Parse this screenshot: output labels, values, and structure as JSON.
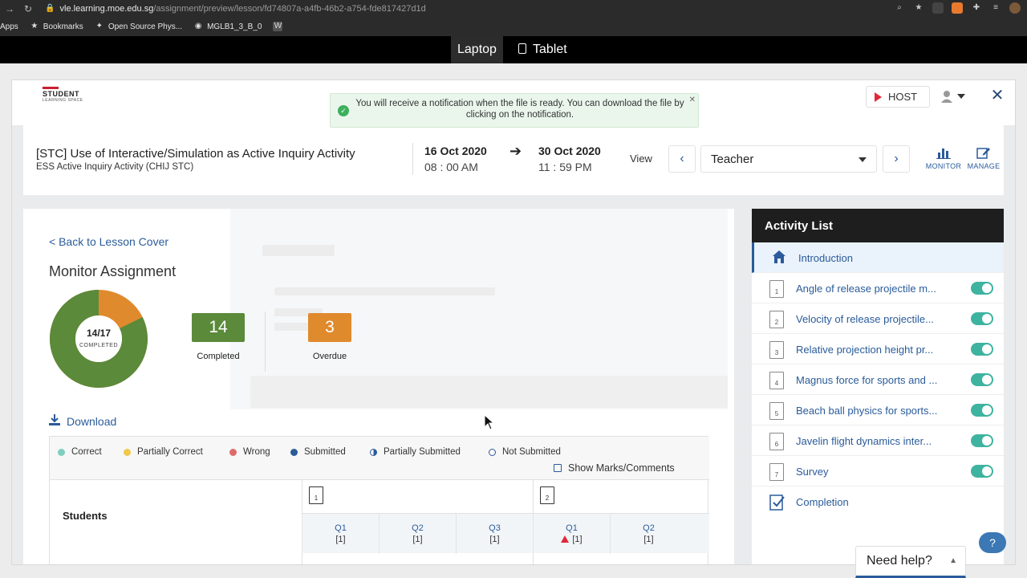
{
  "browser": {
    "url_host": "vle.learning.moe.edu.sg",
    "url_path": "/assignment/preview/lesson/fd74807a-a4fb-46b2-a754-fde817427d1d",
    "bookmarks": [
      "Apps",
      "Bookmarks",
      "Open Source Phys...",
      "MGLB1_3_B_0"
    ]
  },
  "device_toggle": {
    "laptop": "Laptop",
    "tablet": "Tablet",
    "active": "Laptop"
  },
  "header": {
    "logo_line1": "STUDENT",
    "logo_line2": "LEARNING SPACE",
    "host_label": "HOST",
    "toast": "You will receive a notification when the file is ready. You can download the file by clicking on the notification."
  },
  "lesson": {
    "title": "[STC] Use of Interactive/Simulation as Active Inquiry Activity",
    "subtitle": "ESS Active Inquiry Activity (CHIJ STC)",
    "start_date": "16 Oct 2020",
    "start_time": "08 : 00 AM",
    "end_date": "30 Oct 2020",
    "end_time": "11 : 59 PM",
    "view_label": "View",
    "view_value": "Teacher",
    "monitor_label": "MONITOR",
    "manage_label": "MANAGE"
  },
  "monitor": {
    "back_link": "< Back to Lesson Cover",
    "title": "Monitor Assignment",
    "donut_value": "14/17",
    "donut_caption": "COMPLETED",
    "completed_fraction": 0.8235,
    "completed_count": "14",
    "completed_label": "Completed",
    "overdue_count": "3",
    "overdue_label": "Overdue",
    "colors": {
      "completed": "#5a8a3a",
      "overdue": "#e08a2e"
    },
    "download_label": "Download"
  },
  "legend": [
    {
      "label": "Correct",
      "color": "#7fcfc0",
      "style": "solid"
    },
    {
      "label": "Partially Correct",
      "color": "#f0c84a",
      "style": "solid"
    },
    {
      "label": "Wrong",
      "color": "#e06a6a",
      "style": "solid"
    },
    {
      "label": "Submitted",
      "color": "#2a5b9a",
      "style": "solid"
    },
    {
      "label": "Partially Submitted",
      "color": "#2a5b9a",
      "style": "half"
    },
    {
      "label": "Not Submitted",
      "color": "#2a5b9a",
      "style": "ring"
    }
  ],
  "table": {
    "show_marks": "Show Marks/Comments",
    "students_header": "Students",
    "activity_groups": [
      {
        "number": "1"
      },
      {
        "number": "2"
      }
    ],
    "questions": [
      {
        "q": "Q1",
        "marks": "[1]",
        "warning": false
      },
      {
        "q": "Q2",
        "marks": "[1]",
        "warning": false
      },
      {
        "q": "Q3",
        "marks": "[1]",
        "warning": false
      },
      {
        "q": "Q1",
        "marks": "[1]",
        "warning": true
      },
      {
        "q": "Q2",
        "marks": "[1]",
        "warning": false
      }
    ]
  },
  "activity_list": {
    "title": "Activity List",
    "items": [
      {
        "label": "Introduction",
        "icon": "home-icon",
        "selected": true,
        "toggle": false
      },
      {
        "label": "Angle of release projectile m...",
        "number": "1",
        "toggle": true
      },
      {
        "label": "Velocity of release projectile...",
        "number": "2",
        "toggle": true
      },
      {
        "label": "Relative projection height pr...",
        "number": "3",
        "toggle": true
      },
      {
        "label": "Magnus force for sports and ...",
        "number": "4",
        "toggle": true
      },
      {
        "label": "Beach ball physics for sports...",
        "number": "5",
        "toggle": true
      },
      {
        "label": "Javelin flight dynamics inter...",
        "number": "6",
        "toggle": true
      },
      {
        "label": "Survey",
        "number": "7",
        "toggle": true
      },
      {
        "label": "Completion",
        "icon": "checklist-icon",
        "toggle": false
      }
    ]
  },
  "help": {
    "label": "Need help?",
    "question": "?"
  }
}
